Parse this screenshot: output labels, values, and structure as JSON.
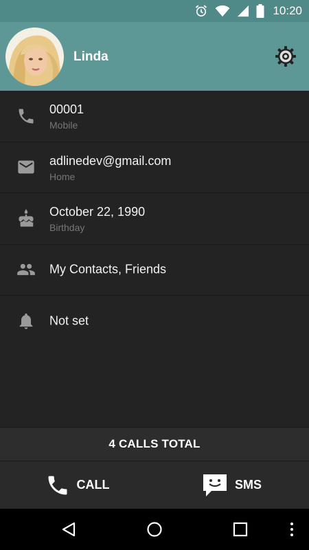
{
  "status_bar": {
    "time": "10:20",
    "icons": [
      "alarm-icon",
      "wifi-icon",
      "signal-icon",
      "battery-icon"
    ]
  },
  "header": {
    "name": "Linda",
    "settings_icon": "gear-icon",
    "colors": {
      "status": "#4f8a88",
      "header": "#5e9896"
    }
  },
  "details": [
    {
      "icon": "phone-icon",
      "primary": "00001",
      "secondary": "Mobile"
    },
    {
      "icon": "email-icon",
      "primary": "adlinedev@gmail.com",
      "secondary": "Home"
    },
    {
      "icon": "cake-icon",
      "primary": "October 22, 1990",
      "secondary": "Birthday"
    },
    {
      "icon": "group-icon",
      "primary": "My Contacts, Friends"
    },
    {
      "icon": "bell-icon",
      "primary": "Not set"
    }
  ],
  "calls_total": "4 CALLS TOTAL",
  "actions": {
    "call": {
      "label": "CALL",
      "icon": "phone-handset-icon"
    },
    "sms": {
      "label": "SMS",
      "icon": "sms-bubble-icon"
    }
  },
  "nav_bar": {
    "buttons": [
      "back-icon",
      "home-icon",
      "recents-icon",
      "overflow-menu-icon"
    ]
  }
}
